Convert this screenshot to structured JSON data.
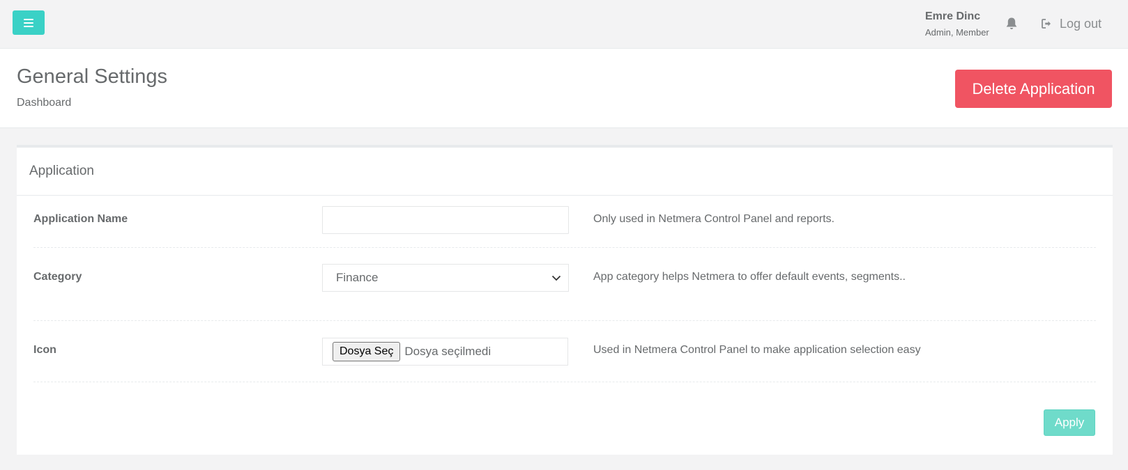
{
  "topbar": {
    "menu_icon": "hamburger-icon",
    "user_name": "Emre Dinc",
    "user_role": "Admin, Member",
    "notification_icon": "bell-icon",
    "logout_icon": "sign-out-icon",
    "logout_label": "Log out"
  },
  "heading": {
    "title": "General Settings",
    "breadcrumb": "Dashboard",
    "delete_label": "Delete Application"
  },
  "card": {
    "title": "Application",
    "rows": {
      "name": {
        "label": "Application Name",
        "value": "",
        "help": "Only used in Netmera Control Panel and reports."
      },
      "category": {
        "label": "Category",
        "selected": "Finance",
        "help": "App category helps Netmera to offer default events, segments.."
      },
      "icon": {
        "label": "Icon",
        "button_label": "Dosya Seç",
        "file_status": "Dosya seçilmedi",
        "help": "Used in Netmera Control Panel to make application selection easy"
      }
    },
    "apply_label": "Apply"
  },
  "colors": {
    "accent": "#3ad1c6",
    "danger": "#f05462",
    "apply": "#6fdbca"
  }
}
